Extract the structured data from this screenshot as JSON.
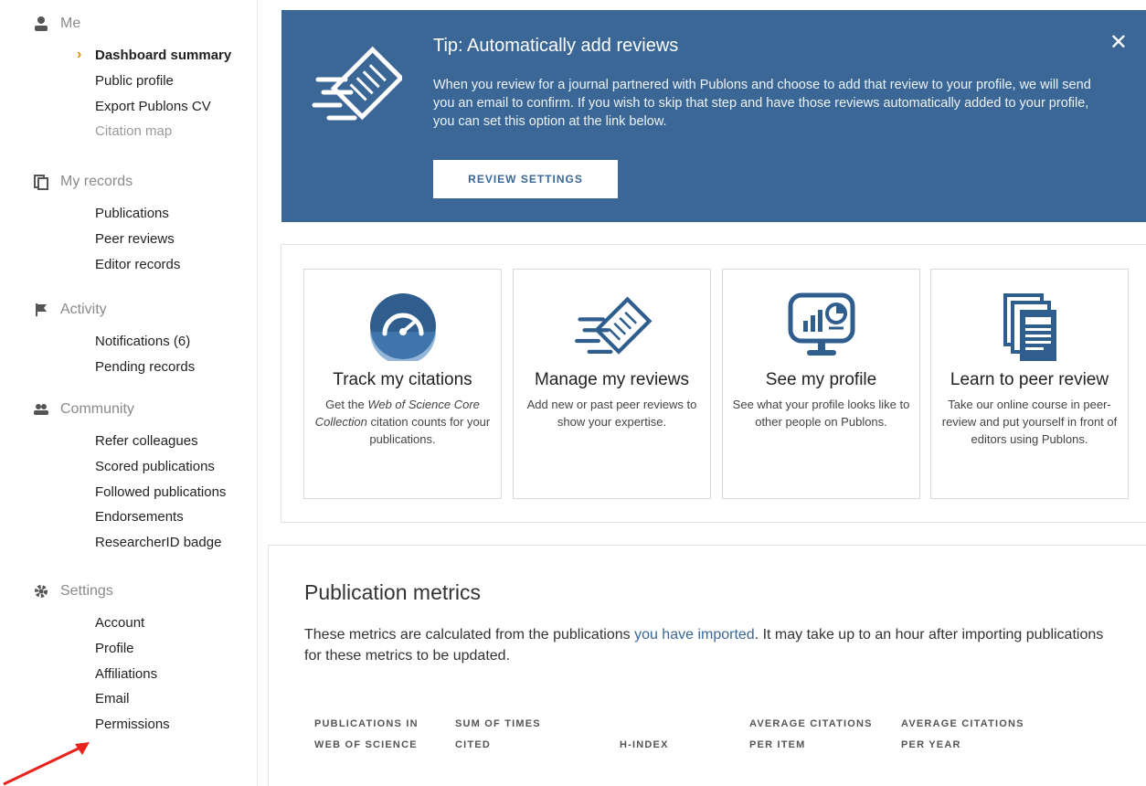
{
  "sidebar": {
    "sections": [
      {
        "title": "Me",
        "icon": "person-icon",
        "items": [
          {
            "label": "Dashboard summary",
            "state": "active"
          },
          {
            "label": "Public profile",
            "state": "normal"
          },
          {
            "label": "Export Publons CV",
            "state": "normal"
          },
          {
            "label": "Citation map",
            "state": "muted"
          }
        ]
      },
      {
        "title": "My records",
        "icon": "copy-icon",
        "items": [
          {
            "label": "Publications",
            "state": "normal"
          },
          {
            "label": "Peer reviews",
            "state": "normal"
          },
          {
            "label": "Editor records",
            "state": "normal"
          }
        ]
      },
      {
        "title": "Activity",
        "icon": "flag-icon",
        "items": [
          {
            "label": "Notifications (6)",
            "state": "normal"
          },
          {
            "label": "Pending records",
            "state": "normal"
          }
        ]
      },
      {
        "title": "Community",
        "icon": "group-icon",
        "items": [
          {
            "label": "Refer colleagues",
            "state": "normal"
          },
          {
            "label": "Scored publications",
            "state": "normal"
          },
          {
            "label": "Followed publications",
            "state": "normal"
          },
          {
            "label": "Endorsements",
            "state": "normal"
          },
          {
            "label": "ResearcherID badge",
            "state": "normal"
          }
        ]
      },
      {
        "title": "Settings",
        "icon": "gear-icon",
        "items": [
          {
            "label": "Account",
            "state": "normal"
          },
          {
            "label": "Profile",
            "state": "normal"
          },
          {
            "label": "Affiliations",
            "state": "normal"
          },
          {
            "label": "Email",
            "state": "normal"
          },
          {
            "label": "Permissions",
            "state": "normal"
          }
        ]
      }
    ]
  },
  "tip": {
    "title": "Tip:  Automatically add reviews",
    "body": "When you review for a journal partnered with Publons and choose to add that review to your profile, we will send you an email to confirm. If you wish to skip that step and have those reviews automatically added to your profile, you can set this option at the link below.",
    "button_label": "REVIEW SETTINGS",
    "close_label": "✕"
  },
  "cards": [
    {
      "title": "Track my citations",
      "desc_html": "Get the <i>Web of Science Core Collection</i> citation counts for your publications.",
      "icon": "gauge-icon"
    },
    {
      "title": "Manage my reviews",
      "desc_html": "Add new or past peer reviews to show your expertise.",
      "icon": "flying-document-icon"
    },
    {
      "title": "See my profile",
      "desc_html": "See what your profile looks like to other people on Publons.",
      "icon": "monitor-chart-icon"
    },
    {
      "title": "Learn to peer review",
      "desc_html": "Take our online course in peer-review and put yourself in front of editors using Publons.",
      "icon": "documents-stack-icon"
    }
  ],
  "metrics": {
    "title": "Publication metrics",
    "desc_before": "These metrics are calculated from the publications ",
    "desc_link": "you have imported",
    "desc_after": ".  It may take up to an hour after importing publications for these metrics to be updated.",
    "columns": [
      {
        "line1": "PUBLICATIONS IN",
        "line2": "WEB OF SCIENCE"
      },
      {
        "line1": "SUM OF TIMES",
        "line2": "CITED"
      },
      {
        "line1": "",
        "line2": "H-INDEX"
      },
      {
        "line1": "AVERAGE CITATIONS",
        "line2": "PER ITEM"
      },
      {
        "line1": "AVERAGE CITATIONS",
        "line2": "PER YEAR"
      }
    ]
  },
  "colors": {
    "banner": "#3a6796",
    "accent_chevron": "#e68a00",
    "annotation_arrow": "#e8231c",
    "icon_blue": "#2f5e8e"
  }
}
